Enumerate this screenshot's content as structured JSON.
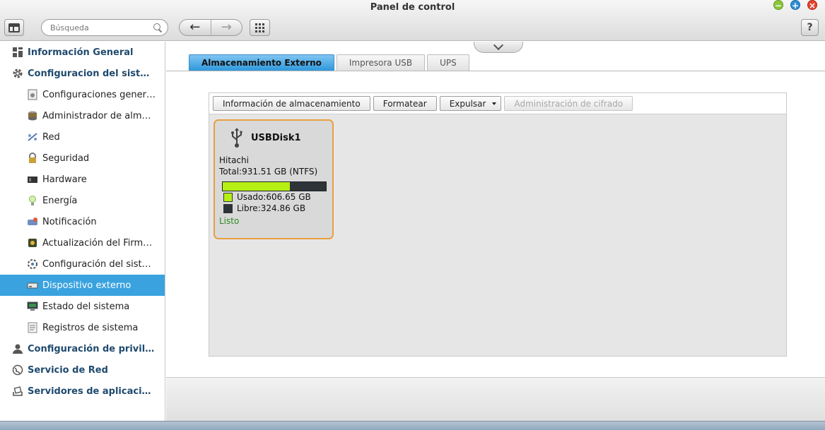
{
  "window": {
    "title": "Panel de control"
  },
  "toolbar": {
    "search_placeholder": "Búsqueda",
    "back_icon": "←",
    "forward_icon": "→",
    "help_label": "?"
  },
  "sidebar": {
    "items": [
      {
        "label": "Información General",
        "level": "top",
        "icon": "overview-icon"
      },
      {
        "label": "Configuracion del sistema",
        "level": "top",
        "icon": "gear-icon"
      },
      {
        "label": "Configuraciones generales",
        "level": "sub",
        "icon": "settings-icon"
      },
      {
        "label": "Administrador de almacenamiento",
        "level": "sub",
        "icon": "storage-icon"
      },
      {
        "label": "Red",
        "level": "sub",
        "icon": "network-icon"
      },
      {
        "label": "Seguridad",
        "level": "sub",
        "icon": "lock-icon"
      },
      {
        "label": "Hardware",
        "level": "sub",
        "icon": "hardware-icon"
      },
      {
        "label": "Energía",
        "level": "sub",
        "icon": "lightbulb-icon"
      },
      {
        "label": "Notificación",
        "level": "sub",
        "icon": "notification-icon"
      },
      {
        "label": "Actualización del Firmware",
        "level": "sub",
        "icon": "firmware-icon"
      },
      {
        "label": "Configuración del sistema",
        "level": "sub",
        "icon": "backup-icon"
      },
      {
        "label": "Dispositivo externo",
        "level": "sub",
        "icon": "external-drive-icon",
        "selected": true
      },
      {
        "label": "Estado del sistema",
        "level": "sub",
        "icon": "monitor-icon"
      },
      {
        "label": "Registros de sistema",
        "level": "sub",
        "icon": "log-icon"
      },
      {
        "label": "Configuración de privilegios",
        "level": "top",
        "icon": "user-icon"
      },
      {
        "label": "Servicio de Red",
        "level": "top",
        "icon": "globe-icon"
      },
      {
        "label": "Servidores de aplicaciones",
        "level": "top",
        "icon": "app-server-icon"
      }
    ]
  },
  "tabs": [
    {
      "label": "Almacenamiento Externo",
      "active": true
    },
    {
      "label": "Impresora USB",
      "active": false
    },
    {
      "label": "UPS",
      "active": false
    }
  ],
  "actions": {
    "storage_info": "Información de almacenamiento",
    "format": "Formatear",
    "eject": "Expulsar",
    "encryption": "Administración de cifrado"
  },
  "disk": {
    "name": "USBDisk1",
    "vendor": "Hitachi",
    "total": "Total:931.51 GB (NTFS)",
    "used": "Usado:606.65 GB",
    "free": "Libre:324.86 GB",
    "status": "Listo",
    "used_fraction": 0.6513,
    "colors": {
      "used": "#b6ef14",
      "free": "#2e3338",
      "border": "#e8a040",
      "status": "#2b8a1f"
    }
  },
  "colors": {
    "accent": "#39a2df",
    "nav_text": "#1f4a6e"
  }
}
